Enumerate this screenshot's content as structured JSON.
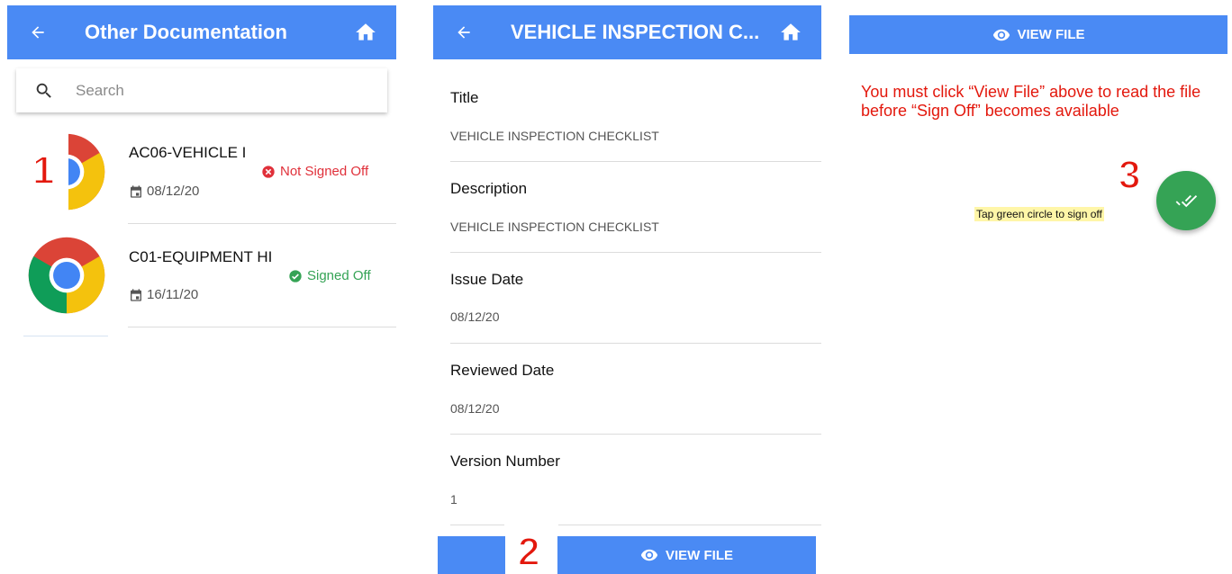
{
  "panel1": {
    "header": {
      "title": "Other Documentation"
    },
    "search": {
      "placeholder": "Search"
    },
    "documents": [
      {
        "name": "AC06-VEHICLE I",
        "date": "08/12/20",
        "status": "Not Signed Off",
        "status_color": "#e0303a"
      },
      {
        "name": "C01-EQUIPMENT HI",
        "date": "16/11/20",
        "status": "Signed Off",
        "status_color": "#35a355"
      }
    ],
    "step_number": "1"
  },
  "panel2": {
    "header": {
      "title": "VEHICLE INSPECTION C..."
    },
    "fields": [
      {
        "label": "Title",
        "value": "VEHICLE INSPECTION CHECKLIST"
      },
      {
        "label": "Description",
        "value": "VEHICLE INSPECTION CHECKLIST"
      },
      {
        "label": "Issue Date",
        "value": "08/12/20"
      },
      {
        "label": "Reviewed Date",
        "value": "08/12/20"
      },
      {
        "label": "Version Number",
        "value": "1"
      }
    ],
    "view_file_label": "VIEW FILE",
    "step_number": "2"
  },
  "panel3": {
    "view_file_label": "VIEW FILE",
    "instruction": "You must click “View File” above to read the file  before “Sign Off” becomes available",
    "hint": "Tap green circle to sign off",
    "step_number": "3"
  },
  "colors": {
    "accent": "#4a8af4",
    "signoff_green": "#35a355",
    "annotation_red": "#e3180d"
  },
  "icons": {
    "back": "arrow-left-icon",
    "home": "home-icon",
    "search": "search-icon",
    "calendar": "calendar-icon",
    "error": "cancel-circle-icon",
    "check": "check-circle-icon",
    "eye": "eye-icon",
    "done_all": "double-check-icon",
    "doc": "chrome-icon"
  }
}
